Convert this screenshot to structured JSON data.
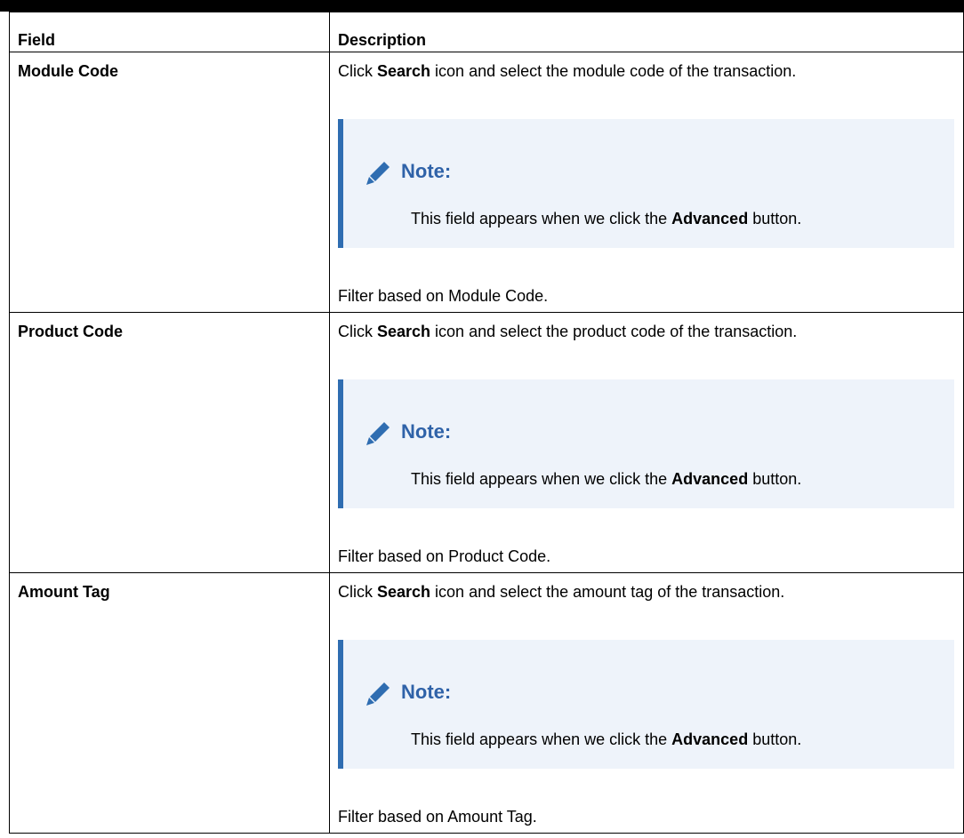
{
  "table": {
    "headers": {
      "field": "Field",
      "description": "Description"
    },
    "rows": [
      {
        "field": "Module Code",
        "desc_prefix": "Click ",
        "desc_bold": "Search",
        "desc_suffix": " icon and select the module code of the transaction.",
        "note_title": "Note:",
        "note_prefix": "This field appears when we click the ",
        "note_bold": "Advanced",
        "note_suffix": " button.",
        "filter": "Filter based on Module Code."
      },
      {
        "field": "Product Code",
        "desc_prefix": "Click ",
        "desc_bold": "Search",
        "desc_suffix": " icon and select the product code of the transaction.",
        "note_title": "Note:",
        "note_prefix": "This field appears when we click the ",
        "note_bold": "Advanced",
        "note_suffix": " button.",
        "filter": "Filter based on Product Code."
      },
      {
        "field": "Amount Tag",
        "desc_prefix": "Click ",
        "desc_bold": "Search",
        "desc_suffix": " icon and select the amount tag of the transaction.",
        "note_title": "Note:",
        "note_prefix": "This field appears when we click the ",
        "note_bold": "Advanced",
        "note_suffix": " button.",
        "filter": "Filter based on Amount Tag."
      }
    ]
  },
  "colors": {
    "note_accent": "#2f6db1",
    "note_background": "#eef3fa",
    "note_title": "#2f62a8"
  },
  "icons": {
    "note": "pencil-icon"
  }
}
